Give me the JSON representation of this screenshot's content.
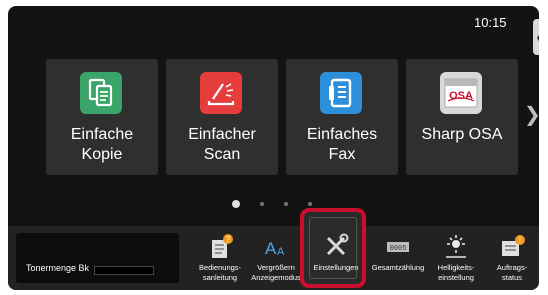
{
  "status": {
    "time": "10:15"
  },
  "side_tab": {
    "icon": "chevron-left-icon"
  },
  "tiles": [
    {
      "label": "Einfache\nKopie",
      "icon": "copy-icon",
      "color": "#3aa56a"
    },
    {
      "label": "Einfacher\nScan",
      "icon": "scan-icon",
      "color": "#e53c3c"
    },
    {
      "label": "Einfaches\nFax",
      "icon": "fax-icon",
      "color": "#2d8fd9"
    },
    {
      "label": "Sharp OSA",
      "icon": "sharp-osa-icon",
      "color": "#d8d8d8"
    }
  ],
  "pagination": {
    "pages": 4,
    "current": 1
  },
  "toner": {
    "label": "Tonermenge Bk",
    "level": 0
  },
  "bottom_buttons": [
    {
      "label": "Bedienungs-\nsanleitung",
      "icon": "manual-icon"
    },
    {
      "label": "Vergrößern\nAnzeigemodus",
      "icon": "magnify-text-icon"
    },
    {
      "label": "Einstellungen",
      "icon": "settings-tools-icon"
    },
    {
      "label": "Gesamtzählung",
      "icon": "counter-icon"
    },
    {
      "label": "Helligkeits-\neinstellung",
      "icon": "brightness-icon"
    },
    {
      "label": "Auftrags-\nstatus",
      "icon": "job-status-icon"
    }
  ],
  "colors": {
    "highlight": "#c8102e",
    "background": "#131313",
    "tile": "#2f2f2f"
  }
}
